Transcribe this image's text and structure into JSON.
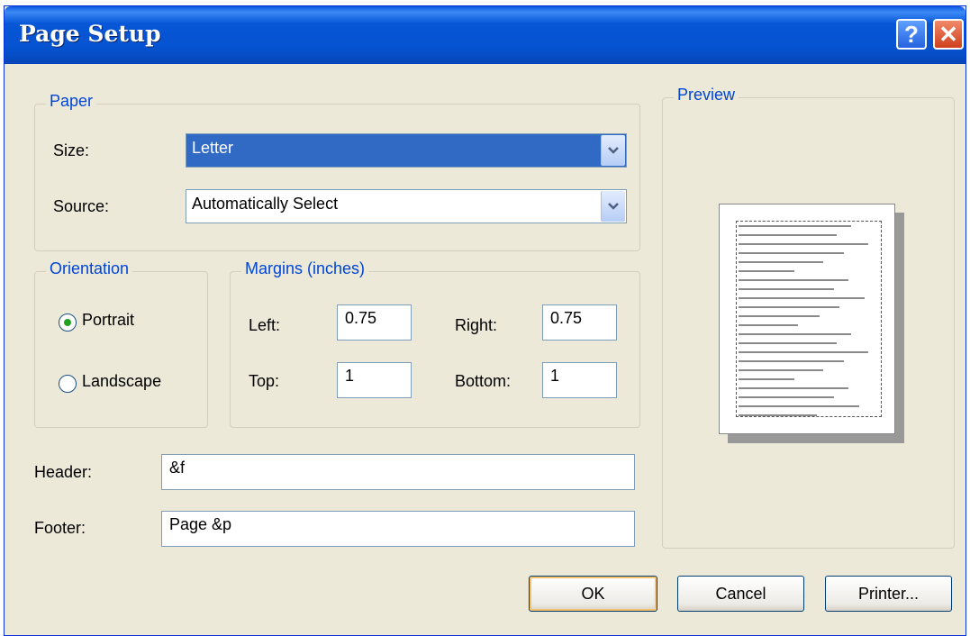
{
  "window": {
    "title": "Page Setup",
    "help_glyph": "?",
    "close_glyph": "✕"
  },
  "paper": {
    "legend": "Paper",
    "size_label": "Size:",
    "size_value": "Letter",
    "source_label": "Source:",
    "source_value": "Automatically Select"
  },
  "orientation": {
    "legend": "Orientation",
    "portrait": "Portrait",
    "landscape": "Landscape",
    "selected": "Portrait"
  },
  "margins": {
    "legend": "Margins (inches)",
    "left_label": "Left:",
    "left_value": "0.75",
    "right_label": "Right:",
    "right_value": "0.75",
    "top_label": "Top:",
    "top_value": "1",
    "bottom_label": "Bottom:",
    "bottom_value": "1"
  },
  "header": {
    "label": "Header:",
    "value": "&f"
  },
  "footer": {
    "label": "Footer:",
    "value": "Page &p"
  },
  "preview": {
    "legend": "Preview"
  },
  "buttons": {
    "ok": "OK",
    "cancel": "Cancel",
    "printer": "Printer..."
  },
  "icons": {
    "dropdown": "chevron-down-icon"
  },
  "colors": {
    "title_bar": "#0553d1",
    "group_legend": "#0046d5",
    "selection": "#316ac5"
  }
}
